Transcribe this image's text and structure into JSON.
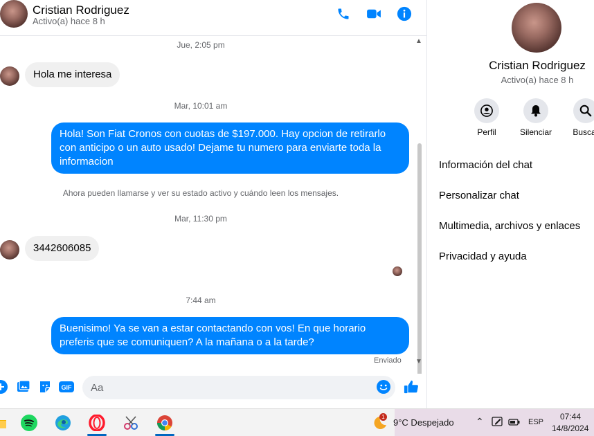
{
  "contact": {
    "name": "Cristian Rodriguez",
    "status": "Activo(a) hace 8 h"
  },
  "header_icons": [
    "phone-icon",
    "video-icon",
    "info-icon"
  ],
  "thread": {
    "ts1": "Jue, 2:05 pm",
    "msg1": "Hola me interesa",
    "ts2": "Mar, 10:01 am",
    "msg2": "Hola! Son Fiat Cronos con cuotas de $197.000. Hay opcion de retirarlo con anticipo o un auto usado! Dejame tu numero para enviarte toda la informacion",
    "system": "Ahora pueden llamarse y ver su estado activo y cuándo leen los mensajes.",
    "ts3": "Mar, 11:30 pm",
    "msg3": "3442606085",
    "ts4": "7:44 am",
    "msg4": "Buenisimo! Ya se van a estar contactando con vos! En que horario preferis que se comuniquen? A la mañana o a la tarde?",
    "sent": "Enviado"
  },
  "composer": {
    "placeholder": "Aa",
    "gif_label": "GIF"
  },
  "panel": {
    "actions": [
      {
        "label": "Perfil",
        "icon": "profile-icon"
      },
      {
        "label": "Silenciar",
        "icon": "bell-icon"
      },
      {
        "label": "Buscar",
        "icon": "search-icon"
      }
    ],
    "menu": [
      "Información del chat",
      "Personalizar chat",
      "Multimedia, archivos y enlaces",
      "Privacidad y ayuda"
    ]
  },
  "taskbar": {
    "weather": "9°C  Despejado",
    "weather_badge": "1",
    "language": "ESP",
    "time": "07:44",
    "date": "14/8/2024"
  },
  "colors": {
    "accent": "#0084ff",
    "incoming_bubble": "#f0f0f0",
    "tray_bg": "#e9dce8"
  }
}
